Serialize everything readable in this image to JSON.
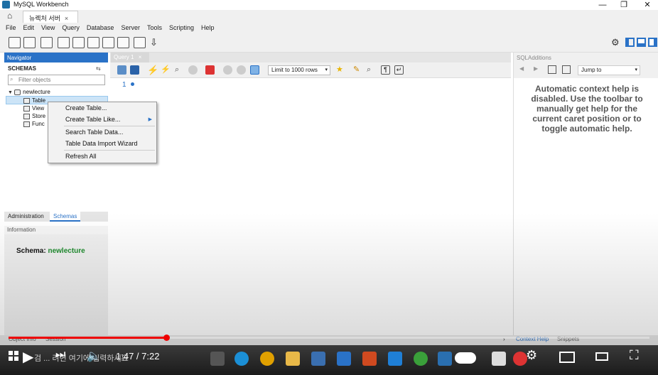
{
  "window": {
    "title": "MySQL Workbench"
  },
  "connection_tab": {
    "label": "뉴렉처 서버",
    "close": "×"
  },
  "menubar": [
    "File",
    "Edit",
    "View",
    "Query",
    "Database",
    "Server",
    "Tools",
    "Scripting",
    "Help"
  ],
  "navigator": {
    "header": "Navigator",
    "schemas_label": "SCHEMAS",
    "filter_placeholder": "Filter objects",
    "tree": {
      "schema": "newlecture",
      "children": [
        "Tables",
        "Views",
        "Stored Procedures",
        "Functions"
      ],
      "children_visible": [
        "Table",
        "View",
        "Store",
        "Func"
      ]
    },
    "tabs": [
      "Administration",
      "Schemas"
    ],
    "info_header": "Information",
    "info_schema_label": "Schema:",
    "info_schema_value": "newlecture"
  },
  "context_menu": {
    "items": [
      "Create Table...",
      "Create Table Like...",
      "Search Table Data...",
      "Table Data Import Wizard",
      "Refresh All"
    ]
  },
  "editor": {
    "tab_label": "Query 1",
    "limit_label": "Limit to 1000 rows",
    "line_number": "1"
  },
  "sql_additions": {
    "header": "SQLAdditions",
    "jump_to": "Jump to",
    "help_text": "Automatic context help is disabled. Use the toolbar to manually get help for the current caret position or to toggle automatic help.",
    "bottom_tabs": [
      "Context Help",
      "Snippets"
    ]
  },
  "bottom_tabs": [
    "Object Info",
    "Session"
  ],
  "video": {
    "time": "1:47 / 7:22",
    "progress": 0.243,
    "caption_fragment": "검 ... 려면 여기에 입력하세요"
  },
  "colors": {
    "accent": "#2a72c7",
    "schema_green": "#1e8c2e",
    "progress": "#e00000"
  }
}
